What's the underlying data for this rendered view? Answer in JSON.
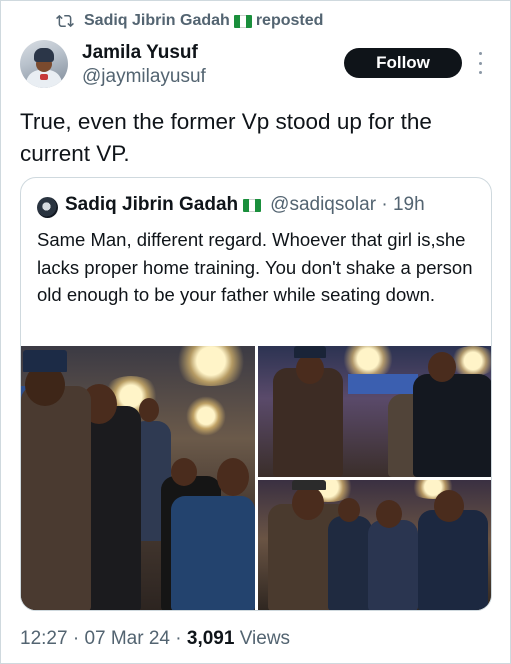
{
  "repost": {
    "user": "Sadiq Jibrin Gadah",
    "label": "reposted"
  },
  "author": {
    "name": "Jamila Yusuf",
    "handle": "@jaymilayusuf"
  },
  "follow_label": "Follow",
  "post_text": "True, even the former Vp stood up for the current VP.",
  "quote": {
    "name": "Sadiq Jibrin Gadah",
    "handle": "@sadiqsolar",
    "separator": "·",
    "time": "19h",
    "text": "Same Man, different regard. Whoever that girl is,she lacks proper home training. You don't shake a person old enough to be your father while seating down."
  },
  "meta": {
    "time": "12:27",
    "sep1": "·",
    "date": "07 Mar 24",
    "sep2": "·",
    "views_count": "3,091",
    "views_label": "Views"
  },
  "icons": {
    "repost": "repost-icon",
    "flag": "nigeria-flag-icon",
    "more": "more-options-icon"
  },
  "colors": {
    "text": "#0f1419",
    "secondary": "#536471",
    "border": "#cfd9de",
    "button": "#0f1419",
    "flag_green": "#1a8f3c"
  }
}
